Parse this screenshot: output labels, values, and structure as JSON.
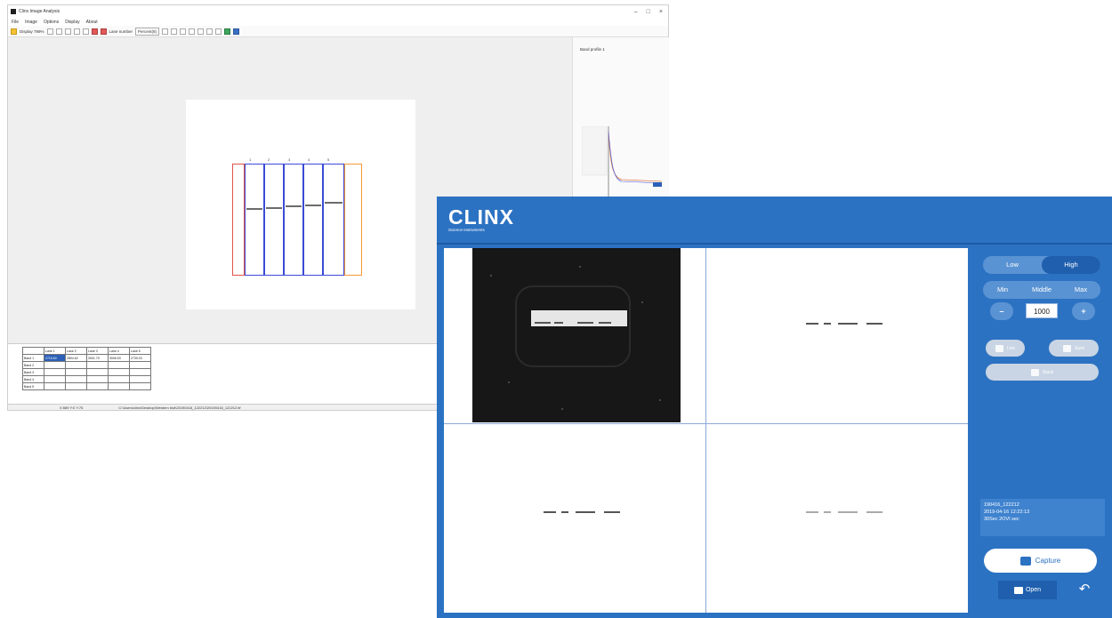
{
  "back_window": {
    "title": "Clinx Image Analysis",
    "window_controls": [
      "–",
      "□",
      "×"
    ],
    "menu": [
      "File",
      "Image",
      "Options",
      "Display",
      "About"
    ],
    "toolbar": {
      "display_label": "Display 789%",
      "lane_number_label": "Lane number",
      "percent_label": "Percent(8)"
    },
    "lane_labels": [
      "1",
      "2",
      "3",
      "4",
      "5"
    ],
    "profile_panel_title": "Band profile 1",
    "table": {
      "header": [
        "",
        "Lane 1",
        "Lane 2",
        "Lane 3",
        "Lane 4",
        "Lane 5"
      ],
      "rows": [
        [
          "Band 1",
          "2715.60",
          "2894.62",
          "3001.79",
          "3006.53",
          "2739.03"
        ],
        [
          "Band 2",
          "",
          "",
          "",
          "",
          ""
        ],
        [
          "Band 3",
          "",
          "",
          "",
          "",
          ""
        ],
        [
          "Band 4",
          "",
          "",
          "",
          "",
          ""
        ],
        [
          "Band 5",
          "",
          "",
          "",
          "",
          ""
        ]
      ]
    },
    "status": {
      "coords": "X:589 Y:0 Y:75",
      "path": "C:\\Users\\clinx\\Desktop\\Western blot\\20190416_122212\\20190416_122212.tif"
    },
    "colors": {
      "lane_first": "#e0534b",
      "lane": "#3a4bd6",
      "lane_last": "#f29a3a",
      "selected_cell": "#2b5fb8"
    }
  },
  "front_window": {
    "logo": "CLINX",
    "tagline": "Science Instruments",
    "exposure_mode": {
      "options": [
        "Low",
        "High"
      ],
      "selected": "High"
    },
    "binning": {
      "options": [
        "Min",
        "Middle",
        "Max"
      ]
    },
    "exposure_value": "1000",
    "stepper": {
      "minus": "–",
      "plus": "+"
    },
    "buttons": {
      "left": "Live",
      "right": "Save",
      "full": "Stack"
    },
    "info_lines": [
      "190416_122212",
      "2019-04-16 12:22:13",
      "30Sec 2OVI sec"
    ],
    "capture_label": "Capture",
    "open_label": "Open",
    "back_icon": "return-icon",
    "colors": {
      "primary": "#2c72c2",
      "dark_primary": "#1f5fae",
      "button_light": "#5a93d3"
    }
  }
}
